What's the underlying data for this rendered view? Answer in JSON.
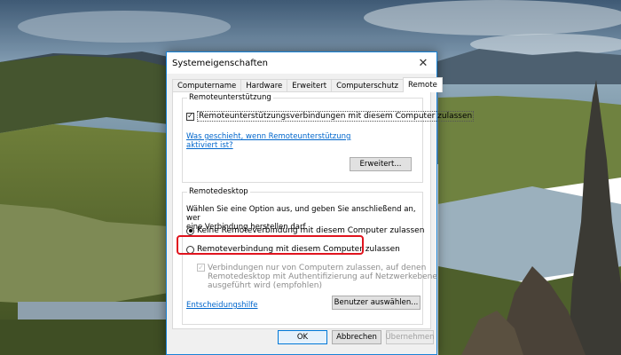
{
  "window": {
    "title": "Systemeigenschaften"
  },
  "tabs": [
    {
      "label": "Computername"
    },
    {
      "label": "Hardware"
    },
    {
      "label": "Erweitert"
    },
    {
      "label": "Computerschutz"
    },
    {
      "label": "Remote"
    }
  ],
  "remote_assistance": {
    "group_title": "Remoteunterstützung",
    "checkbox_label": "Remoteunterstützungsverbindungen mit diesem Computer zulassen",
    "checkbox_checked": true,
    "help_link_line1": "Was geschieht, wenn Remoteunterstützung",
    "help_link_line2": "aktiviert ist?",
    "advanced_button": "Erweitert..."
  },
  "remote_desktop": {
    "group_title": "Remotedesktop",
    "intro_line1": "Wählen Sie eine Option aus, und geben Sie anschließend an, wer",
    "intro_line2": "eine Verbindung herstellen darf.",
    "option_none": "Keine Remoteverbindung mit diesem Computer zulassen",
    "option_allow": "Remoteverbindung mit diesem Computer zulassen",
    "selected_option": "none",
    "nla_line1": "Verbindungen nur von Computern zulassen, auf denen",
    "nla_line2": "Remotedesktop mit Authentifizierung auf Netzwerkebene",
    "nla_line3": "ausgeführt wird (empfohlen)",
    "help_link": "Entscheidungshilfe",
    "select_users_button": "Benutzer auswählen..."
  },
  "footer": {
    "ok": "OK",
    "cancel": "Abbrechen",
    "apply": "Übernehmen"
  },
  "colors": {
    "accent": "#0078d7",
    "highlight": "#e0141e",
    "link": "#0066cc"
  }
}
